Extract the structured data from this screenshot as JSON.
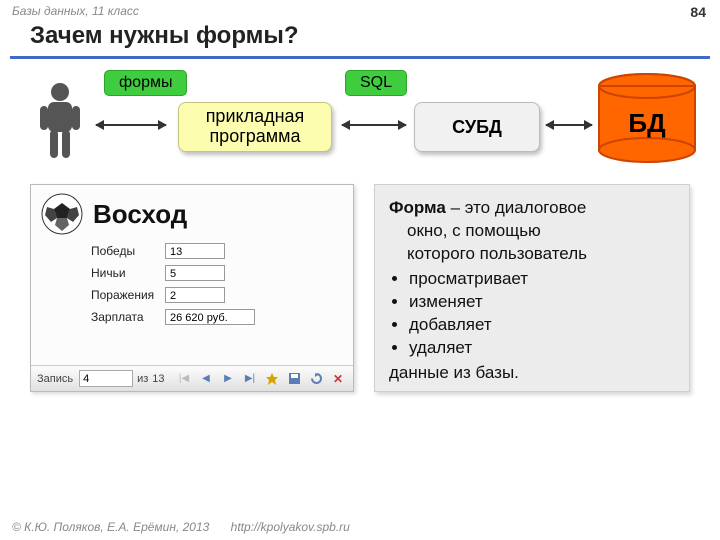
{
  "header": "Базы данных, 11 класс",
  "page_number": "84",
  "title": "Зачем нужны формы?",
  "diagram": {
    "forms_label": "формы",
    "sql_label": "SQL",
    "app_line1": "прикладная",
    "app_line2": "программа",
    "dbms": "СУБД",
    "db": "БД"
  },
  "form": {
    "title": "Восход",
    "rows": [
      {
        "label": "Победы",
        "value": "13"
      },
      {
        "label": "Ничьи",
        "value": "5"
      },
      {
        "label": "Поражения",
        "value": "2"
      },
      {
        "label": "Зарплата",
        "value": "26 620 руб."
      }
    ],
    "nav": {
      "record_label": "Запись",
      "current": "4",
      "of_label": "из",
      "total": "13"
    }
  },
  "definition": {
    "term": "Форма",
    "intro1": " – это диалоговое",
    "intro2": "окно, с помощью",
    "intro3": "которого пользователь",
    "bullets": [
      "просматривает",
      "изменяет",
      "добавляет",
      "удаляет"
    ],
    "outro": "данные из базы."
  },
  "footer": {
    "copyright": "© К.Ю. Поляков, Е.А. Ерёмин, 2013",
    "url": "http://kpolyakov.spb.ru"
  }
}
